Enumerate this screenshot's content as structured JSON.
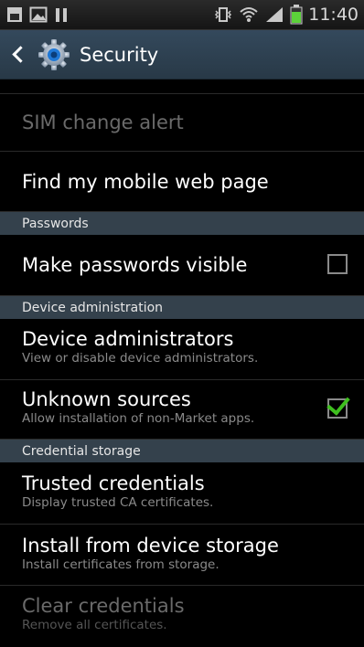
{
  "status_bar": {
    "time": "11:40",
    "icons": [
      "sim-icon",
      "image-icon",
      "pause-icon",
      "vibrate-icon",
      "wifi-icon",
      "signal-icon",
      "battery-icon"
    ]
  },
  "action_bar": {
    "title": "Security",
    "icon": "settings-gear-icon"
  },
  "list": {
    "sim_change_alert": {
      "title": "SIM change alert",
      "enabled": false
    },
    "find_my_mobile": {
      "title": "Find my mobile web page"
    },
    "section_passwords": "Passwords",
    "make_passwords_visible": {
      "title": "Make passwords visible",
      "checked": false
    },
    "section_device_admin": "Device administration",
    "device_administrators": {
      "title": "Device administrators",
      "subtitle": "View or disable device administrators."
    },
    "unknown_sources": {
      "title": "Unknown sources",
      "subtitle": "Allow installation of non-Market apps.",
      "checked": true
    },
    "section_credential_storage": "Credential storage",
    "trusted_credentials": {
      "title": "Trusted credentials",
      "subtitle": "Display trusted CA certificates."
    },
    "install_from_storage": {
      "title": "Install from device storage",
      "subtitle": "Install certificates from storage."
    },
    "clear_credentials": {
      "title": "Clear credentials",
      "subtitle": "Remove all certificates.",
      "enabled": false
    }
  },
  "colors": {
    "accent_check": "#3fbf1f",
    "section_bg": "#34414c",
    "action_bar": "#2f4252"
  }
}
